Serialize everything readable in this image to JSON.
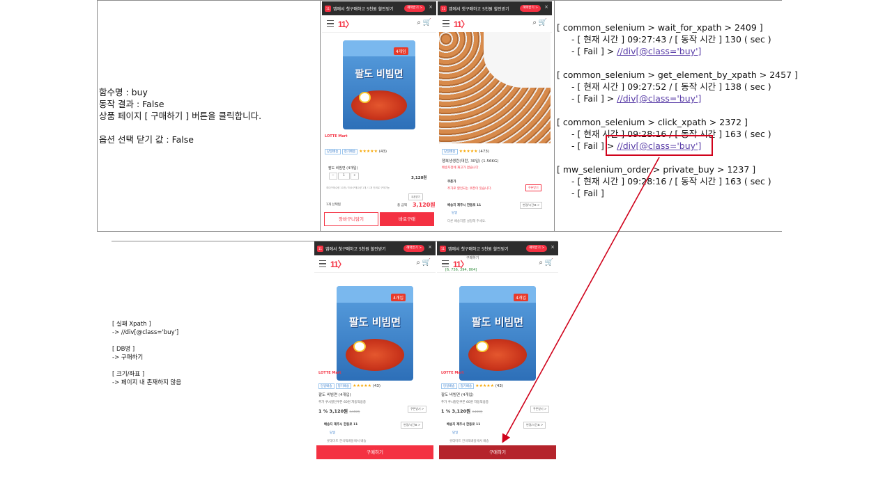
{
  "top_info": {
    "line1": "함수명 : buy",
    "line2": "동작 결과 : False",
    "line3": "상품 페이지 [ 구매하기 ] 버튼을 클릭합니다.",
    "line5": "옵션 선택 닫기 값 : False"
  },
  "log": [
    {
      "head": "[ common_selenium > wait_for_xpath > 2409 ]",
      "time": "- [ 현재 시간 ] 09:27:43 / [ 동작 시간 ] 130 ( sec )",
      "fail": "- [ Fail ] > ",
      "xpath": "//div[@class='buy']"
    },
    {
      "head": "[ common_selenium > get_element_by_xpath > 2457 ]",
      "time": "- [ 현재 시간 ] 09:27:52 / [ 동작 시간 ] 138 ( sec )",
      "fail": "- [ Fail ] > ",
      "xpath": "//div[@class='buy']"
    },
    {
      "head": "[ common_selenium > click_xpath > 2372 ]",
      "time": "- [ 현재 시간 ] 09:28:16 / [ 동작 시간 ] 163 ( sec )",
      "fail": "- [ Fail ] > ",
      "xpath": "//div[@class='buy']"
    },
    {
      "head": "[ mw_selenium_order > private_buy > 1237 ]",
      "time": "- [ 현재 시간 ] 09:28:16 / [ 동작 시간 ] 163 ( sec )",
      "fail": "- [ Fail ]",
      "xpath": ""
    }
  ],
  "bottom_info": {
    "l1": "[ 실패 Xpath ]",
    "l2": "-> //div[@class='buy']",
    "l3": "[ DB명 ]",
    "l4": "-> 구매하기",
    "l5": "[ 크기/좌표 ]",
    "l6": "-> 페이지 내 존재하지 않음"
  },
  "phone_common": {
    "banner_text": "앱에서 첫구매하고 5천원 할인받기",
    "banner_icon": "11",
    "banner_btn": "혜택받기 >",
    "banner_close": "×",
    "logo": "11〉",
    "search_icon": "⌕",
    "cart_icon": "🛒",
    "brand": "LOTTE Mart",
    "pack_title": "팔도 비빔면",
    "pack_badge": "4개입",
    "tag1": "당일배송",
    "tag2": "정기배송",
    "stars": "★★★★★",
    "review_count": "(43)",
    "product_name": "팔도 비빔면 (4개입)",
    "coupon_text": "추가 쿠시할인쿠폰 60원 자동적용중",
    "coupon_btn": "쿠폰받기 >",
    "price_line": "1 % 3,120원",
    "orig_price": "3,150원",
    "ship_to": "배송지 제주시 한동로 11",
    "ship_btn": "변경/시간표 >",
    "dangbal": "당일",
    "ship_note": "롯데마트 한국택배을에서 배송",
    "buy_label": "구매하기"
  },
  "phone_a": {
    "option_label": "팔도 비빔면 (4개입)",
    "qty": "1",
    "minus": "−",
    "plus": "+",
    "option_price": "3,120원",
    "fine_print": "최대구매수량 10개 / 최소구매수량 1개 / 1개 단위로 구매가능",
    "cart_opt": "쿠폰받기",
    "selected": "1개 선택됨",
    "total_label": "총 금액",
    "total": "3,120원",
    "cart_btn": "장바구니담기",
    "buy_now": "바로구매"
  },
  "phone_b": {
    "review_count": "(473)",
    "product_name": "행복생생란(대란, 30입) (1.56KG)",
    "note": "배송지정에 재고가 없습니다.",
    "coupon_head": "쿠폰가",
    "coupon_text": "추가로 할인되는 쿠폰이 있습니다.",
    "coupon_btn": "쿠폰받기",
    "ship_to": "배송지 제주시 한동로 11",
    "ship_btn": "변경/시간표 >",
    "dangbal": "당일",
    "ship_note": "다른 배송지를 설정해 주세요."
  },
  "phone_d": {
    "overlay1": "구매하기",
    "overlay2": "[6, 756, 394, 804]"
  },
  "colors": {
    "accent": "#f43142",
    "annotation": "#d0021b",
    "link": "#5b3fa8"
  }
}
